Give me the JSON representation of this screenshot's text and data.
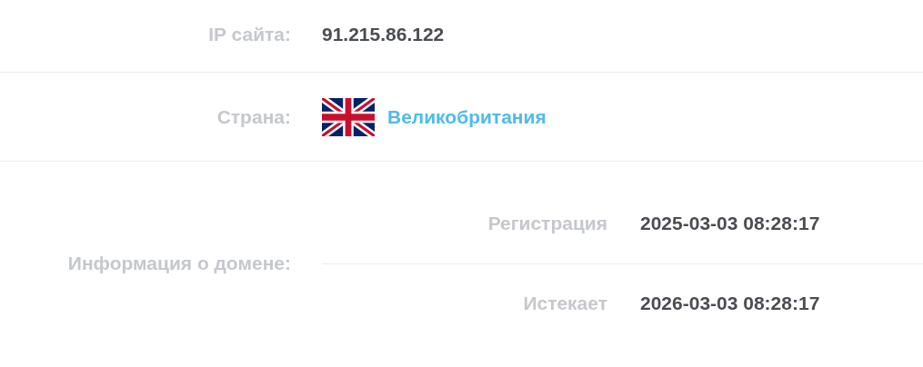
{
  "rows": [
    {
      "kind": "text",
      "label": "IP сайта:",
      "value": "91.215.86.122"
    },
    {
      "kind": "country",
      "label": "Страна:",
      "value": "Великобритания"
    },
    {
      "kind": "nested",
      "label": "Информация о домене:",
      "items": [
        {
          "label": "Регистрация",
          "value": "2025-03-03 08:28:17"
        },
        {
          "label": "Истекает",
          "value": "2026-03-03 08:28:17"
        }
      ]
    }
  ]
}
